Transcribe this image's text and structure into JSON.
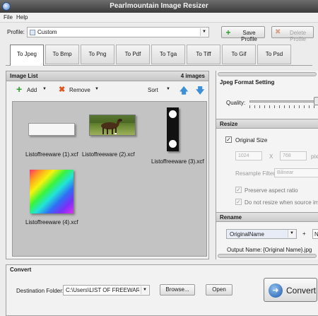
{
  "window": {
    "title": "Pearlmountain Image Resizer"
  },
  "menu": {
    "file": "File",
    "help": "Help"
  },
  "profile": {
    "label": "Profile:",
    "value": "Custom",
    "save_label": "Save Profile",
    "delete_label": "Delete Profile"
  },
  "tabs": [
    {
      "label": "To Jpeg"
    },
    {
      "label": "To Bmp"
    },
    {
      "label": "To Png"
    },
    {
      "label": "To Pdf"
    },
    {
      "label": "To Tga"
    },
    {
      "label": "To Tiff"
    },
    {
      "label": "To Gif"
    },
    {
      "label": "To Psd"
    }
  ],
  "image_list": {
    "title": "Image List",
    "count": "4 images",
    "add_label": "Add",
    "remove_label": "Remove",
    "sort_label": "Sort",
    "items": [
      {
        "name": "Listoffreeware (1).xcf"
      },
      {
        "name": "Listoffreeware (2).xcf"
      },
      {
        "name": "Listoffreeware (3).xcf"
      },
      {
        "name": "Listoffreeware (4).xcf"
      }
    ]
  },
  "jpeg": {
    "title": "Jpeg Format Setting",
    "quality_label": "Quality:"
  },
  "resize": {
    "title": "Resize",
    "original_size": "Original Size",
    "width": "1024",
    "height": "768",
    "x_sep": "X",
    "unit": "pixe",
    "filter_label": "Resample Filter:",
    "filter_value": "Bilinear",
    "preserve": "Preserve aspect ratio",
    "no_resize": "Do not resize when source imag"
  },
  "rename": {
    "title": "Rename",
    "pattern": "OriginalName",
    "plus": "+",
    "second": "N",
    "output_label": "Output Name:",
    "output_value": "{Original Name}.jpg"
  },
  "convert": {
    "title": "Convert",
    "dest_label": "Destination Folder:",
    "dest_value": "C:\\Users\\LIST OF FREEWARE\\D",
    "browse_label": "Browse...",
    "open_label": "Open",
    "convert_label": "Convert"
  }
}
